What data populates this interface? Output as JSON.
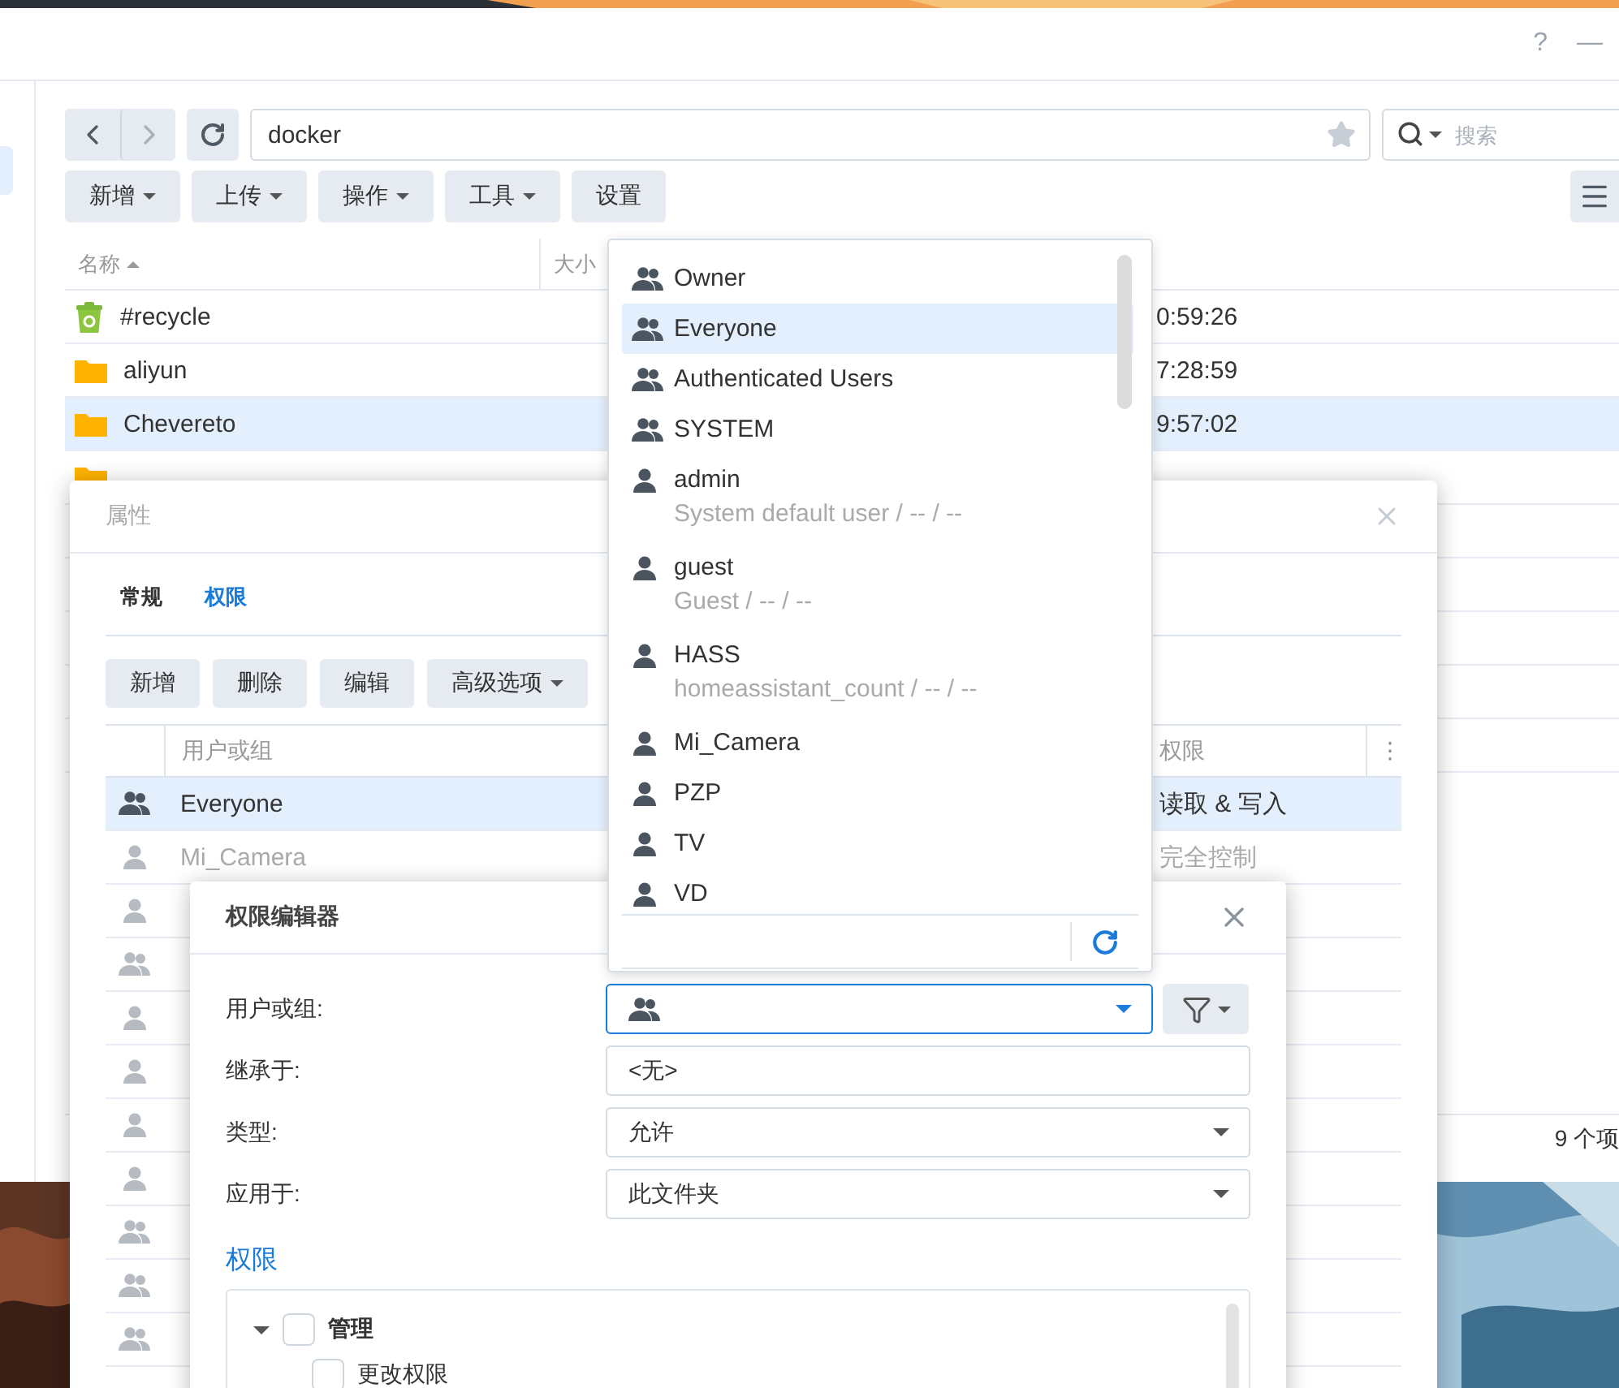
{
  "file_station": {
    "window_buttons": [
      "?",
      "—"
    ],
    "path": "docker",
    "search": {
      "placeholder": "搜索"
    },
    "toolbar": [
      {
        "label": "新增",
        "menu": true
      },
      {
        "label": "上传",
        "menu": true
      },
      {
        "label": "操作",
        "menu": true
      },
      {
        "label": "工具",
        "menu": true
      },
      {
        "label": "设置",
        "menu": false
      }
    ],
    "columns": [
      {
        "label": "名称",
        "sorted": true
      },
      {
        "label": "大小",
        "sorted": false
      }
    ],
    "rows": [
      {
        "name": "#recycle",
        "kind": "recycle",
        "modified": "0:59:26",
        "selected": false
      },
      {
        "name": "aliyun",
        "kind": "folder",
        "modified": "7:28:59",
        "selected": false
      },
      {
        "name": "Chevereto",
        "kind": "folder",
        "modified": "9:57:02",
        "selected": true
      },
      {
        "kind": "folder",
        "selected": false
      }
    ],
    "status": "9 个项"
  },
  "properties": {
    "title": "属性",
    "tabs": [
      {
        "label": "常规",
        "selected": false
      },
      {
        "label": "权限",
        "selected": true
      }
    ],
    "buttons": [
      {
        "label": "新增",
        "menu": false
      },
      {
        "label": "删除",
        "menu": false
      },
      {
        "label": "编辑",
        "menu": false
      },
      {
        "label": "高级选项",
        "menu": true
      }
    ],
    "columns": [
      "用户或组",
      "权限"
    ],
    "column_menu": "⋮",
    "rows": [
      {
        "name": "Everyone",
        "kind": "group",
        "permission": "读取 & 写入",
        "selected": true,
        "inherited": false
      },
      {
        "name": "Mi_Camera",
        "kind": "user",
        "permission": "完全控制",
        "selected": false,
        "inherited": true
      },
      {
        "kind": "user",
        "selected": false,
        "inherited": true
      },
      {
        "kind": "group",
        "selected": false,
        "inherited": true
      },
      {
        "kind": "user",
        "selected": false,
        "inherited": true
      },
      {
        "kind": "user",
        "selected": false,
        "inherited": true
      },
      {
        "kind": "user",
        "selected": false,
        "inherited": true
      },
      {
        "kind": "user",
        "selected": false,
        "inherited": true
      },
      {
        "kind": "group",
        "selected": false,
        "inherited": true
      },
      {
        "kind": "group",
        "selected": false,
        "inherited": true
      },
      {
        "kind": "group",
        "selected": false,
        "inherited": true
      }
    ]
  },
  "permission_editor": {
    "title": "权限编辑器",
    "fields": [
      {
        "label": "用户或组:",
        "kind": "principal",
        "focused": true
      },
      {
        "label": "继承于:",
        "kind": "text",
        "value": "<无>",
        "focused": false
      },
      {
        "label": "类型:",
        "kind": "select",
        "value": "允许",
        "focused": false
      },
      {
        "label": "应用于:",
        "kind": "select",
        "value": "此文件夹",
        "focused": false
      }
    ],
    "section": "权限",
    "tree": [
      {
        "label": "管理",
        "checked": false,
        "expanded": true,
        "children": [
          {
            "label": "更改权限",
            "checked": false
          }
        ]
      }
    ]
  },
  "dropdown": {
    "items": [
      {
        "name": "Owner",
        "kind": "group",
        "selected": false
      },
      {
        "name": "Everyone",
        "kind": "group",
        "selected": true
      },
      {
        "name": "Authenticated Users",
        "kind": "group",
        "selected": false
      },
      {
        "name": "SYSTEM",
        "kind": "group",
        "selected": false
      },
      {
        "name": "admin",
        "kind": "user",
        "detail": "System default user / -- / --",
        "selected": false
      },
      {
        "name": "guest",
        "kind": "user",
        "detail": "Guest / -- / --",
        "selected": false
      },
      {
        "name": "HASS",
        "kind": "user",
        "detail": "homeassistant_count / -- / --",
        "selected": false
      },
      {
        "name": "Mi_Camera",
        "kind": "user",
        "selected": false
      },
      {
        "name": "PZP",
        "kind": "user",
        "selected": false
      },
      {
        "name": "TV",
        "kind": "user",
        "selected": false
      },
      {
        "name": "VD",
        "kind": "user",
        "selected": false
      }
    ]
  }
}
